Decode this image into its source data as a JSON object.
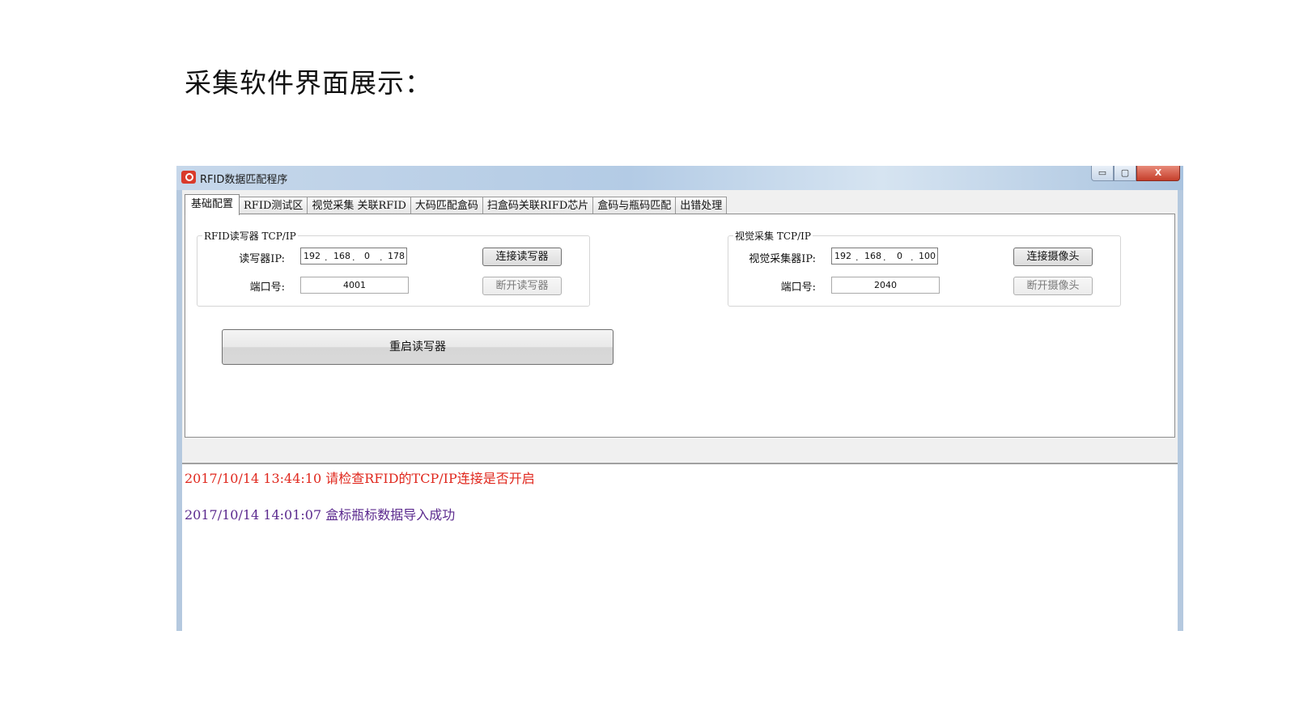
{
  "slide": {
    "title": "采集软件界面展示："
  },
  "window": {
    "title": "RFID数据匹配程序",
    "controls": {
      "minimize": "▭",
      "maximize": "▢",
      "close": "X"
    }
  },
  "tabs": [
    {
      "label": "基础配置",
      "active": true
    },
    {
      "label": "RFID测试区"
    },
    {
      "label": "视觉采集 关联RFID"
    },
    {
      "label": "大码匹配盒码"
    },
    {
      "label": "扫盒码关联RIFD芯片"
    },
    {
      "label": "盒码与瓶码匹配"
    },
    {
      "label": "出错处理"
    }
  ],
  "rfid_group": {
    "title": "RFID读写器 TCP/IP",
    "ip_label": "读写器IP:",
    "ip": {
      "o1": "192",
      "o2": "168",
      "o3": "0",
      "o4": "178"
    },
    "port_label": "端口号:",
    "port": "4001",
    "connect_label": "连接读写器",
    "disconnect_label": "断开读写器"
  },
  "vision_group": {
    "title": "视觉采集 TCP/IP",
    "ip_label": "视觉采集器IP:",
    "ip": {
      "o1": "192",
      "o2": "168",
      "o3": "0",
      "o4": "100"
    },
    "port_label": "端口号:",
    "port": "2040",
    "connect_label": "连接摄像头",
    "disconnect_label": "断开摄像头"
  },
  "restart_label": "重启读写器",
  "log": [
    {
      "text": "2017/10/14 13:44:10 请检查RFID的TCP/IP连接是否开启",
      "color": "#e0281e"
    },
    {
      "text": "2017/10/14 14:01:07 盒标瓶标数据导入成功",
      "color": "#5b2a8e"
    }
  ]
}
